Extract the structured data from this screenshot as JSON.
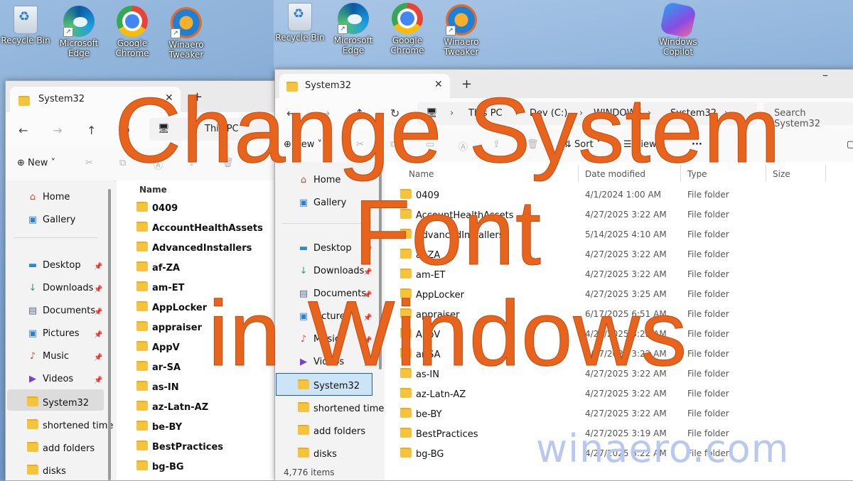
{
  "desktop_left_icons": [
    {
      "label": "Recycle Bin",
      "icon": "recycle-bin-icon"
    },
    {
      "label": "Microsoft Edge",
      "icon": "edge-icon"
    },
    {
      "label": "Google Chrome",
      "icon": "chrome-icon"
    },
    {
      "label": "Winaero Tweaker",
      "icon": "winaero-tweaker-icon"
    }
  ],
  "desktop_right_icons": [
    {
      "label": "Recycle Bin",
      "icon": "recycle-bin-icon"
    },
    {
      "label": "Microsoft Edge",
      "icon": "edge-icon"
    },
    {
      "label": "Google Chrome",
      "icon": "chrome-icon"
    },
    {
      "label": "Winaero Tweaker",
      "icon": "winaero-tweaker-icon"
    },
    {
      "label": "Windows Copilot",
      "icon": "copilot-icon"
    }
  ],
  "left_window": {
    "tab_title": "System32",
    "address": "This PC",
    "new_label": "New",
    "column_name": "Name",
    "nav": {
      "home": "Home",
      "gallery": "Gallery",
      "pinned": [
        "Desktop",
        "Downloads",
        "Documents",
        "Pictures",
        "Music",
        "Videos"
      ],
      "selected": "System32",
      "more": [
        "shortened time",
        "add folders",
        "disks"
      ]
    },
    "files": [
      "0409",
      "AccountHealthAssets",
      "AdvancedInstallers",
      "af-ZA",
      "am-ET",
      "AppLocker",
      "appraiser",
      "AppV",
      "ar-SA",
      "as-IN",
      "az-Latn-AZ",
      "be-BY",
      "BestPractices",
      "bg-BG"
    ]
  },
  "right_window": {
    "tab_title": "System32",
    "breadcrumb": [
      "This PC",
      "Dev (C:)",
      "WINDOWS",
      "System32"
    ],
    "search_placeholder": "Search System32",
    "commands": {
      "new": "New",
      "sort": "Sort",
      "view": "View"
    },
    "columns": {
      "name": "Name",
      "date": "Date modified",
      "type": "Type",
      "size": "Size"
    },
    "nav": {
      "home": "Home",
      "gallery": "Gallery",
      "pinned": [
        "Desktop",
        "Downloads",
        "Documents",
        "Pictures",
        "Music",
        "Videos"
      ],
      "selected": "System32",
      "more": [
        "shortened time",
        "add folders",
        "disks"
      ]
    },
    "files": [
      {
        "name": "0409",
        "date": "4/1/2024 1:00 AM",
        "type": "File folder"
      },
      {
        "name": "AccountHealthAssets",
        "date": "4/27/2025 3:22 AM",
        "type": "File folder"
      },
      {
        "name": "AdvancedInstallers",
        "date": "5/14/2025 4:10 AM",
        "type": "File folder"
      },
      {
        "name": "af-ZA",
        "date": "4/27/2025 3:22 AM",
        "type": "File folder"
      },
      {
        "name": "am-ET",
        "date": "4/27/2025 3:22 AM",
        "type": "File folder"
      },
      {
        "name": "AppLocker",
        "date": "4/27/2025 3:25 AM",
        "type": "File folder"
      },
      {
        "name": "appraiser",
        "date": "6/17/2025 6:51 AM",
        "type": "File folder"
      },
      {
        "name": "AppV",
        "date": "4/27/2025 3:22 AM",
        "type": "File folder"
      },
      {
        "name": "ar-SA",
        "date": "4/27/2025 3:22 AM",
        "type": "File folder"
      },
      {
        "name": "as-IN",
        "date": "4/27/2025 3:22 AM",
        "type": "File folder"
      },
      {
        "name": "az-Latn-AZ",
        "date": "4/27/2025 3:22 AM",
        "type": "File folder"
      },
      {
        "name": "be-BY",
        "date": "4/27/2025 3:22 AM",
        "type": "File folder"
      },
      {
        "name": "BestPractices",
        "date": "4/27/2025 3:19 AM",
        "type": "File folder"
      },
      {
        "name": "bg-BG",
        "date": "4/27/2025 3:22 AM",
        "type": "File folder"
      }
    ],
    "status": "4,776 items"
  },
  "overlay": {
    "line1": "Change System",
    "line2": "Font",
    "line3": "in Windows"
  },
  "watermark": "winaero.com",
  "colors": {
    "overlay": "#e8641c",
    "accent": "#1a5fb4",
    "folder": "#f6c43c"
  }
}
